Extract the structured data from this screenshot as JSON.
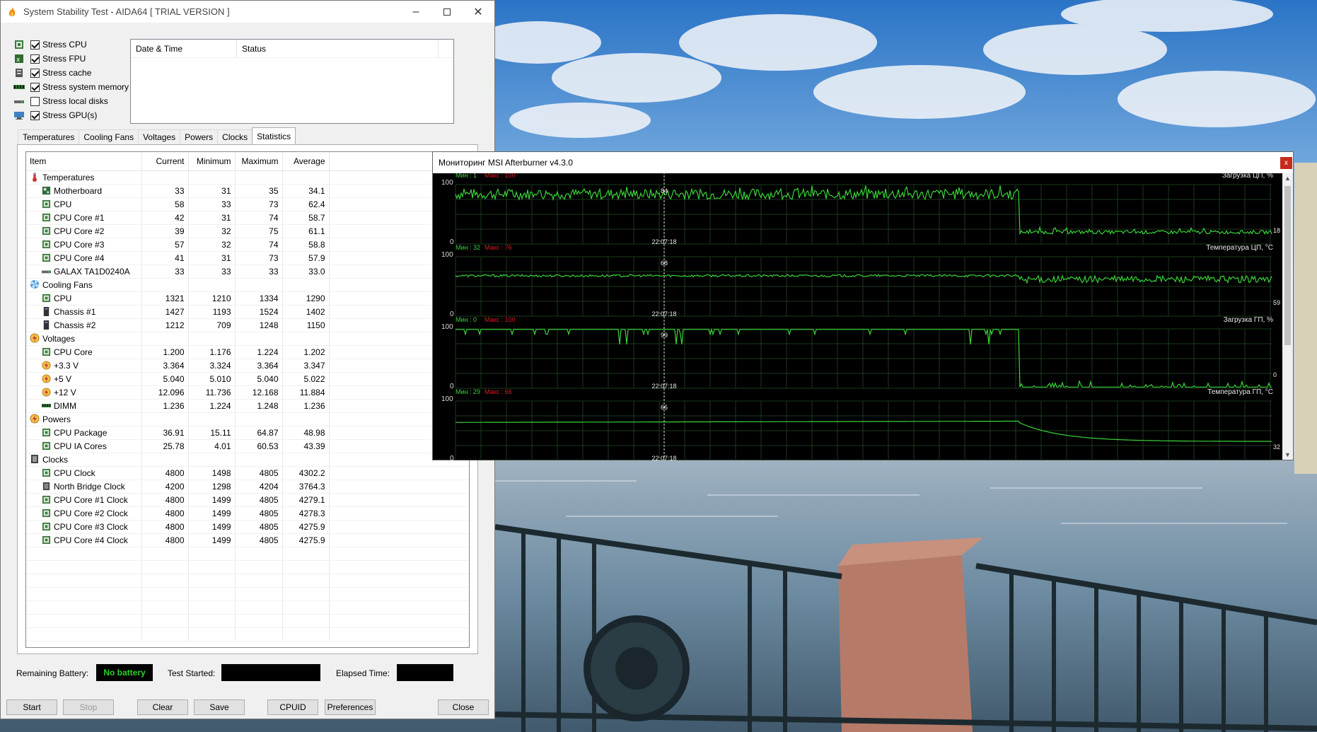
{
  "aida": {
    "title": "System Stability Test - AIDA64  [ TRIAL VERSION ]",
    "options": [
      {
        "label": "Stress CPU",
        "checked": true,
        "icon": "cpu-icon"
      },
      {
        "label": "Stress FPU",
        "checked": true,
        "icon": "fpu-icon"
      },
      {
        "label": "Stress cache",
        "checked": true,
        "icon": "cache-icon"
      },
      {
        "label": "Stress system memory",
        "checked": true,
        "icon": "memory-icon"
      },
      {
        "label": "Stress local disks",
        "checked": false,
        "icon": "disk-icon"
      },
      {
        "label": "Stress GPU(s)",
        "checked": true,
        "icon": "gpu-icon"
      }
    ],
    "log_headers": [
      "Date & Time",
      "Status"
    ],
    "tabs": [
      "Temperatures",
      "Cooling Fans",
      "Voltages",
      "Powers",
      "Clocks",
      "Statistics"
    ],
    "active_tab": "Statistics",
    "columns": [
      "Item",
      "Current",
      "Minimum",
      "Maximum",
      "Average"
    ],
    "rows": [
      {
        "type": "group",
        "label": "Temperatures",
        "icon": "thermometer-icon"
      },
      {
        "type": "item",
        "label": "Motherboard",
        "icon": "motherboard-icon",
        "cur": "33",
        "min": "31",
        "max": "35",
        "avg": "34.1"
      },
      {
        "type": "item",
        "label": "CPU",
        "icon": "cpu-icon",
        "cur": "58",
        "min": "33",
        "max": "73",
        "avg": "62.4"
      },
      {
        "type": "item",
        "label": "CPU Core #1",
        "icon": "cpu-icon",
        "cur": "42",
        "min": "31",
        "max": "74",
        "avg": "58.7"
      },
      {
        "type": "item",
        "label": "CPU Core #2",
        "icon": "cpu-icon",
        "cur": "39",
        "min": "32",
        "max": "75",
        "avg": "61.1"
      },
      {
        "type": "item",
        "label": "CPU Core #3",
        "icon": "cpu-icon",
        "cur": "57",
        "min": "32",
        "max": "74",
        "avg": "58.8"
      },
      {
        "type": "item",
        "label": "CPU Core #4",
        "icon": "cpu-icon",
        "cur": "41",
        "min": "31",
        "max": "73",
        "avg": "57.9"
      },
      {
        "type": "item",
        "label": "GALAX TA1D0240A",
        "icon": "disk-icon",
        "cur": "33",
        "min": "33",
        "max": "33",
        "avg": "33.0"
      },
      {
        "type": "group",
        "label": "Cooling Fans",
        "icon": "fan-icon"
      },
      {
        "type": "item",
        "label": "CPU",
        "icon": "cpu-icon",
        "cur": "1321",
        "min": "1210",
        "max": "1334",
        "avg": "1290"
      },
      {
        "type": "item",
        "label": "Chassis #1",
        "icon": "chassis-icon",
        "cur": "1427",
        "min": "1193",
        "max": "1524",
        "avg": "1402"
      },
      {
        "type": "item",
        "label": "Chassis #2",
        "icon": "chassis-icon",
        "cur": "1212",
        "min": "709",
        "max": "1248",
        "avg": "1150"
      },
      {
        "type": "group",
        "label": "Voltages",
        "icon": "voltage-icon"
      },
      {
        "type": "item",
        "label": "CPU Core",
        "icon": "cpu-icon",
        "cur": "1.200",
        "min": "1.176",
        "max": "1.224",
        "avg": "1.202"
      },
      {
        "type": "item",
        "label": "+3.3 V",
        "icon": "voltage-icon",
        "cur": "3.364",
        "min": "3.324",
        "max": "3.364",
        "avg": "3.347"
      },
      {
        "type": "item",
        "label": "+5 V",
        "icon": "voltage-icon",
        "cur": "5.040",
        "min": "5.010",
        "max": "5.040",
        "avg": "5.022"
      },
      {
        "type": "item",
        "label": "+12 V",
        "icon": "voltage-icon",
        "cur": "12.096",
        "min": "11.736",
        "max": "12.168",
        "avg": "11.884"
      },
      {
        "type": "item",
        "label": "DIMM",
        "icon": "memory-icon",
        "cur": "1.236",
        "min": "1.224",
        "max": "1.248",
        "avg": "1.236"
      },
      {
        "type": "group",
        "label": "Powers",
        "icon": "voltage-icon"
      },
      {
        "type": "item",
        "label": "CPU Package",
        "icon": "cpu-icon",
        "cur": "36.91",
        "min": "15.11",
        "max": "64.87",
        "avg": "48.98"
      },
      {
        "type": "item",
        "label": "CPU IA Cores",
        "icon": "cpu-icon",
        "cur": "25.78",
        "min": "4.01",
        "max": "60.53",
        "avg": "43.39"
      },
      {
        "type": "group",
        "label": "Clocks",
        "icon": "clock-chip-icon"
      },
      {
        "type": "item",
        "label": "CPU Clock",
        "icon": "cpu-icon",
        "cur": "4800",
        "min": "1498",
        "max": "4805",
        "avg": "4302.2"
      },
      {
        "type": "item",
        "label": "North Bridge Clock",
        "icon": "chip-icon",
        "cur": "4200",
        "min": "1298",
        "max": "4204",
        "avg": "3764.3"
      },
      {
        "type": "item",
        "label": "CPU Core #1 Clock",
        "icon": "cpu-icon",
        "cur": "4800",
        "min": "1499",
        "max": "4805",
        "avg": "4279.1"
      },
      {
        "type": "item",
        "label": "CPU Core #2 Clock",
        "icon": "cpu-icon",
        "cur": "4800",
        "min": "1499",
        "max": "4805",
        "avg": "4278.3"
      },
      {
        "type": "item",
        "label": "CPU Core #3 Clock",
        "icon": "cpu-icon",
        "cur": "4800",
        "min": "1499",
        "max": "4805",
        "avg": "4275.9"
      },
      {
        "type": "item",
        "label": "CPU Core #4 Clock",
        "icon": "cpu-icon",
        "cur": "4800",
        "min": "1499",
        "max": "4805",
        "avg": "4275.9"
      }
    ],
    "status": {
      "battery_label": "Remaining Battery:",
      "battery_value": "No battery",
      "started_label": "Test Started:",
      "elapsed_label": "Elapsed Time:"
    },
    "buttons": {
      "start": "Start",
      "stop": "Stop",
      "clear": "Clear",
      "save": "Save",
      "cpuid": "CPUID",
      "preferences": "Preferences",
      "close": "Close"
    }
  },
  "msi": {
    "title": "Мониторинг MSI Afterburner v4.3.0",
    "close_glyph": "x",
    "graphs": [
      {
        "name": "Загрузка ЦП, %",
        "min_label": "Мин : 1",
        "max_label": "Макс : 100",
        "top": "100",
        "bottom": "0",
        "time": "22:07:18",
        "marker_value": "84",
        "current": "18"
      },
      {
        "name": "Температура ЦП, °С",
        "min_label": "Мин : 32",
        "max_label": "Макс : 76",
        "top": "100",
        "bottom": "0",
        "time": "22:07:18",
        "marker_value": "68",
        "current": "59"
      },
      {
        "name": "Загрузка ГП, %",
        "min_label": "Мин : 0",
        "max_label": "Макс : 100",
        "top": "100",
        "bottom": "0",
        "time": "22:07:18",
        "marker_value": "99",
        "current": "0"
      },
      {
        "name": "Температура ГП, °С",
        "min_label": "Мин : 29",
        "max_label": "Макс : 66",
        "top": "100",
        "bottom": "0",
        "time": "22:07:18",
        "marker_value": "66",
        "current": "32"
      }
    ],
    "colors": {
      "line": "#39d439",
      "grid": "#1d3a1d",
      "max_text": "#d02020",
      "min_text": "#39d439"
    }
  }
}
